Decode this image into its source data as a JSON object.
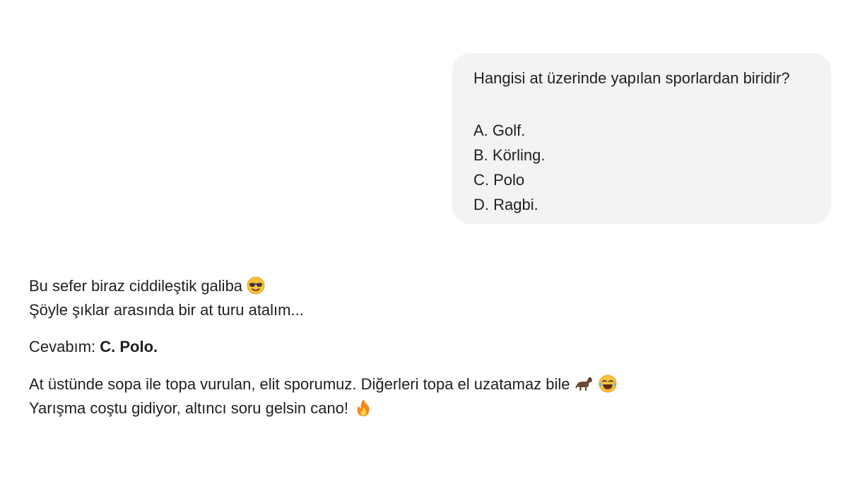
{
  "user_message": {
    "question": "Hangisi at üzerinde yapılan sporlardan biridir?",
    "options": [
      "A. Golf.",
      "B. Körling.",
      "C. Polo",
      "D. Ragbi."
    ]
  },
  "assistant_message": {
    "line1": "Bu sefer biraz ciddileştik galiba",
    "line2": "Şöyle şıklar arasında bir at turu atalım...",
    "answer_prefix": "Cevabım: ",
    "answer_value": "C. Polo.",
    "line4": "At üstünde sopa ile topa vurulan, elit sporumuz. Diğerleri topa el uzatamaz bile",
    "line5": "Yarışma coştu gidiyor, altıncı soru gelsin cano!",
    "emoji_icons": {
      "line1": "smiling-face-with-sunglasses-icon",
      "line4a": "horse-icon",
      "line4b": "tears-of-joy-icon",
      "line5": "fire-icon"
    }
  },
  "colors": {
    "page_background": "#ffffff",
    "user_bubble_background": "#f3f3f3",
    "text": "#1f1f1f"
  }
}
